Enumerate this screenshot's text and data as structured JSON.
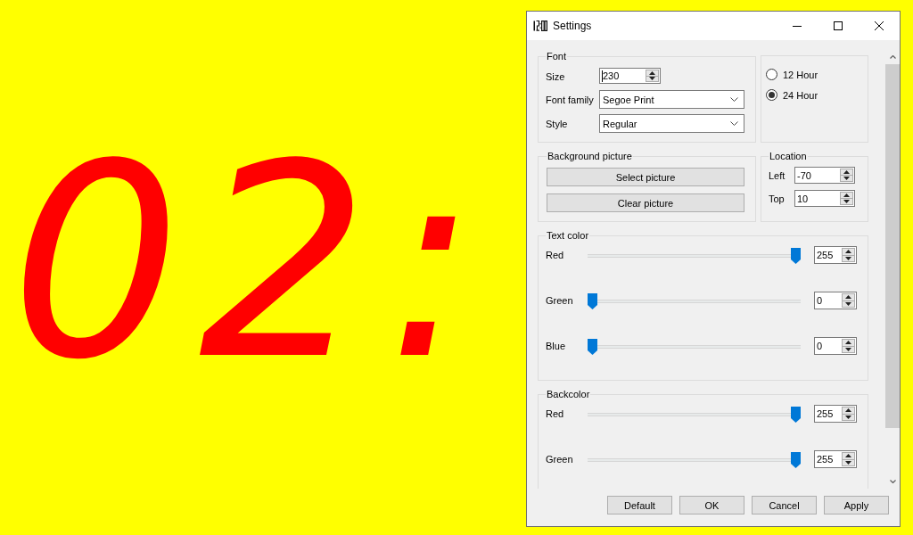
{
  "clock": {
    "text": "02:"
  },
  "window": {
    "title": "Settings"
  },
  "font": {
    "legend": "Font",
    "size": {
      "label": "Size",
      "value": "230",
      "focused": true
    },
    "family": {
      "label": "Font family",
      "value": "Segoe Print"
    },
    "style": {
      "label": "Style",
      "value": "Regular"
    }
  },
  "hour_format": [
    {
      "label": "12 Hour",
      "selected": false
    },
    {
      "label": "24 Hour",
      "selected": true
    }
  ],
  "background_picture": {
    "legend": "Background picture",
    "buttons": [
      "Select picture",
      "Clear picture"
    ]
  },
  "location": {
    "legend": "Location",
    "fields": [
      {
        "label": "Left",
        "value": "-70"
      },
      {
        "label": "Top",
        "value": "10"
      }
    ]
  },
  "text_color": {
    "legend": "Text color",
    "channels": [
      {
        "name": "Red",
        "level": 1,
        "value": "255"
      },
      {
        "name": "Green",
        "level": 0,
        "value": "0"
      },
      {
        "name": "Blue",
        "level": 0,
        "value": "0"
      }
    ]
  },
  "backcolor": {
    "legend": "Backcolor",
    "channels": [
      {
        "name": "Red",
        "level": 1,
        "value": "255"
      },
      {
        "name": "Green",
        "level": 1,
        "value": "255"
      }
    ]
  },
  "buttons": [
    "Default",
    "OK",
    "Cancel",
    "Apply"
  ]
}
